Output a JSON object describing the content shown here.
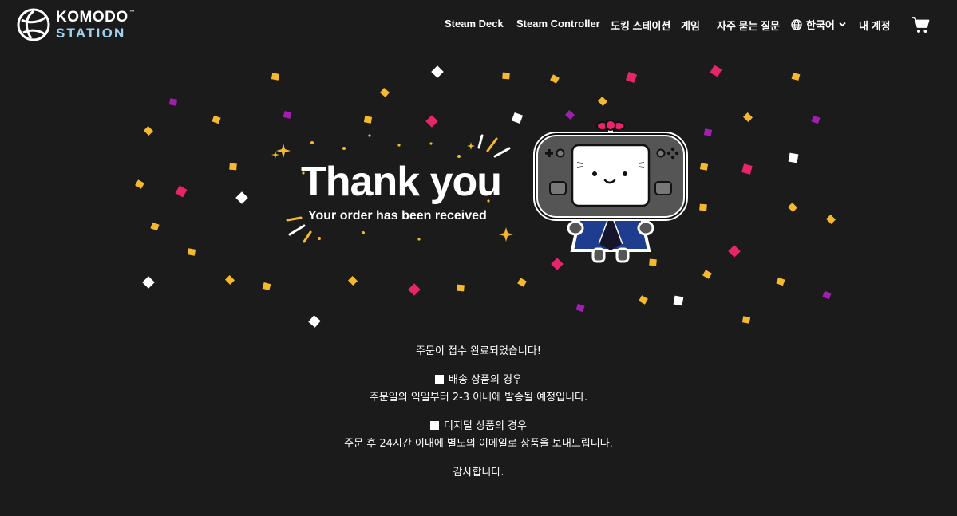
{
  "header": {
    "logo": {
      "line1": "KOMODO",
      "tm": "™",
      "line2": "STATION"
    },
    "nav": [
      "Steam Deck",
      "Steam Controller",
      "도킹 스테이션",
      "게임",
      "자주 묻는 질문"
    ],
    "language": "한국어",
    "account": "내 계정",
    "icons": {
      "language": "globe-icon",
      "language_dropdown": "chevron-down-icon",
      "cart": "cart-icon"
    }
  },
  "hero": {
    "title": "Thank you",
    "subtitle": "Your order has been received",
    "colors": {
      "yellow": "#f5b92e",
      "magenta": "#e8256a",
      "purple": "#a11fb0",
      "white": "#ffffff",
      "accent_logo": "#9fd1f0"
    }
  },
  "message": {
    "complete": "주문이 접수 완료되었습니다!",
    "shipping_title": "배송 상품의 경우",
    "shipping_body": "주문일의 익일부터 2-3 이내에 발송될 예정입니다.",
    "digital_title": "디지털 상품의 경우",
    "digital_body": "주문 후 24시간 이내에 별도의 이메일로 상품을 보내드립니다.",
    "thanks": "감사합니다."
  }
}
